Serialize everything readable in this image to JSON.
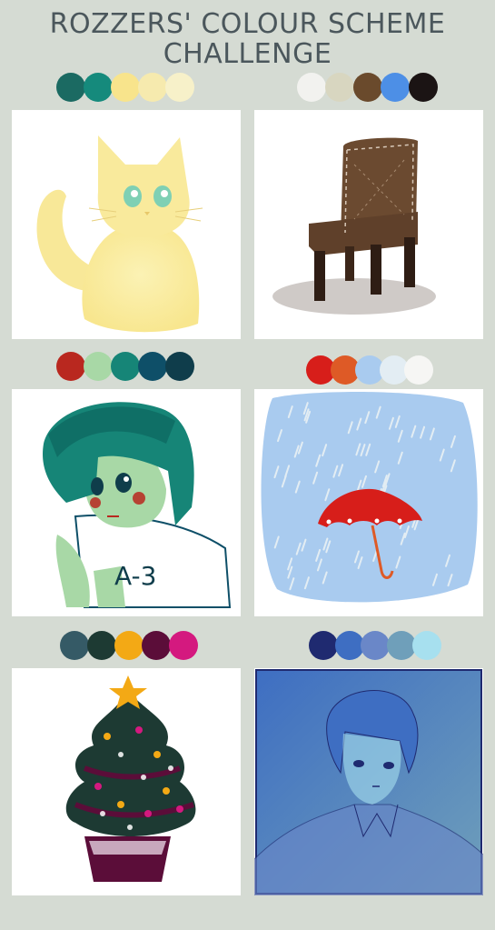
{
  "title": {
    "line1": "ROZZERS' COLOUR SCHEME",
    "line2": "CHALLENGE"
  },
  "palettes": [
    {
      "name": "palette-1",
      "colors": [
        "#1b6a62",
        "#158a7c",
        "#f8e48c",
        "#f6eaae",
        "#f7f1c9"
      ]
    },
    {
      "name": "palette-2",
      "colors": [
        "#f2f2ef",
        "#d8d6c0",
        "#6a4a2c",
        "#4d8fe6",
        "#1b1414"
      ]
    },
    {
      "name": "palette-3",
      "colors": [
        "#b9281f",
        "#a8d8a6",
        "#168577",
        "#0e4f68",
        "#0f3d4b"
      ]
    },
    {
      "name": "palette-4",
      "colors": [
        "#d71e1a",
        "#de5a26",
        "#a9cbef",
        "#e3edf3",
        "#f6f6f4"
      ]
    },
    {
      "name": "palette-5",
      "colors": [
        "#355a66",
        "#1d3a33",
        "#f3a915",
        "#5b0d39",
        "#d4197f"
      ]
    },
    {
      "name": "palette-6",
      "colors": [
        "#1f2a70",
        "#3e6ec2",
        "#6a87c8",
        "#6f9fba",
        "#a7e0ef"
      ]
    }
  ],
  "artworks": [
    {
      "name": "cat-drawing",
      "subject": "cat"
    },
    {
      "name": "chair-drawing",
      "subject": "chair"
    },
    {
      "name": "boy-drawing",
      "subject": "boy",
      "shirt_text": "A-3"
    },
    {
      "name": "umbrella-rain-drawing",
      "subject": "umbrella in rain"
    },
    {
      "name": "christmas-tree-drawing",
      "subject": "christmas tree"
    },
    {
      "name": "man-portrait-drawing",
      "subject": "man portrait"
    }
  ]
}
